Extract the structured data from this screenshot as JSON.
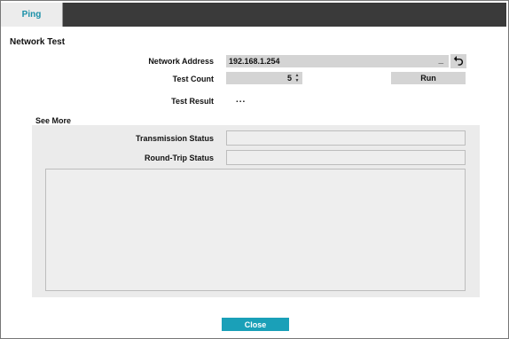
{
  "tabs": [
    {
      "label": "Ping"
    }
  ],
  "network_test": {
    "title": "Network Test",
    "address_label": "Network Address",
    "address_value": "192.168.1.254",
    "address_cursor": "_",
    "count_label": "Test Count",
    "count_value": "5",
    "run_label": "Run",
    "result_label": "Test Result",
    "result_value": "..."
  },
  "see_more": {
    "title": "See More",
    "transmission_label": "Transmission Status",
    "transmission_value": "",
    "roundtrip_label": "Round-Trip Status",
    "roundtrip_value": "",
    "log_text": ""
  },
  "footer": {
    "close_label": "Close"
  },
  "icons": {
    "undo": "undo-arrow-icon",
    "spin_up": "chevron-up-icon",
    "spin_down": "chevron-down-icon"
  },
  "colors": {
    "accent": "#1aa0b8",
    "tab_text": "#1a90a8",
    "tabbar": "#3a3a3a"
  }
}
